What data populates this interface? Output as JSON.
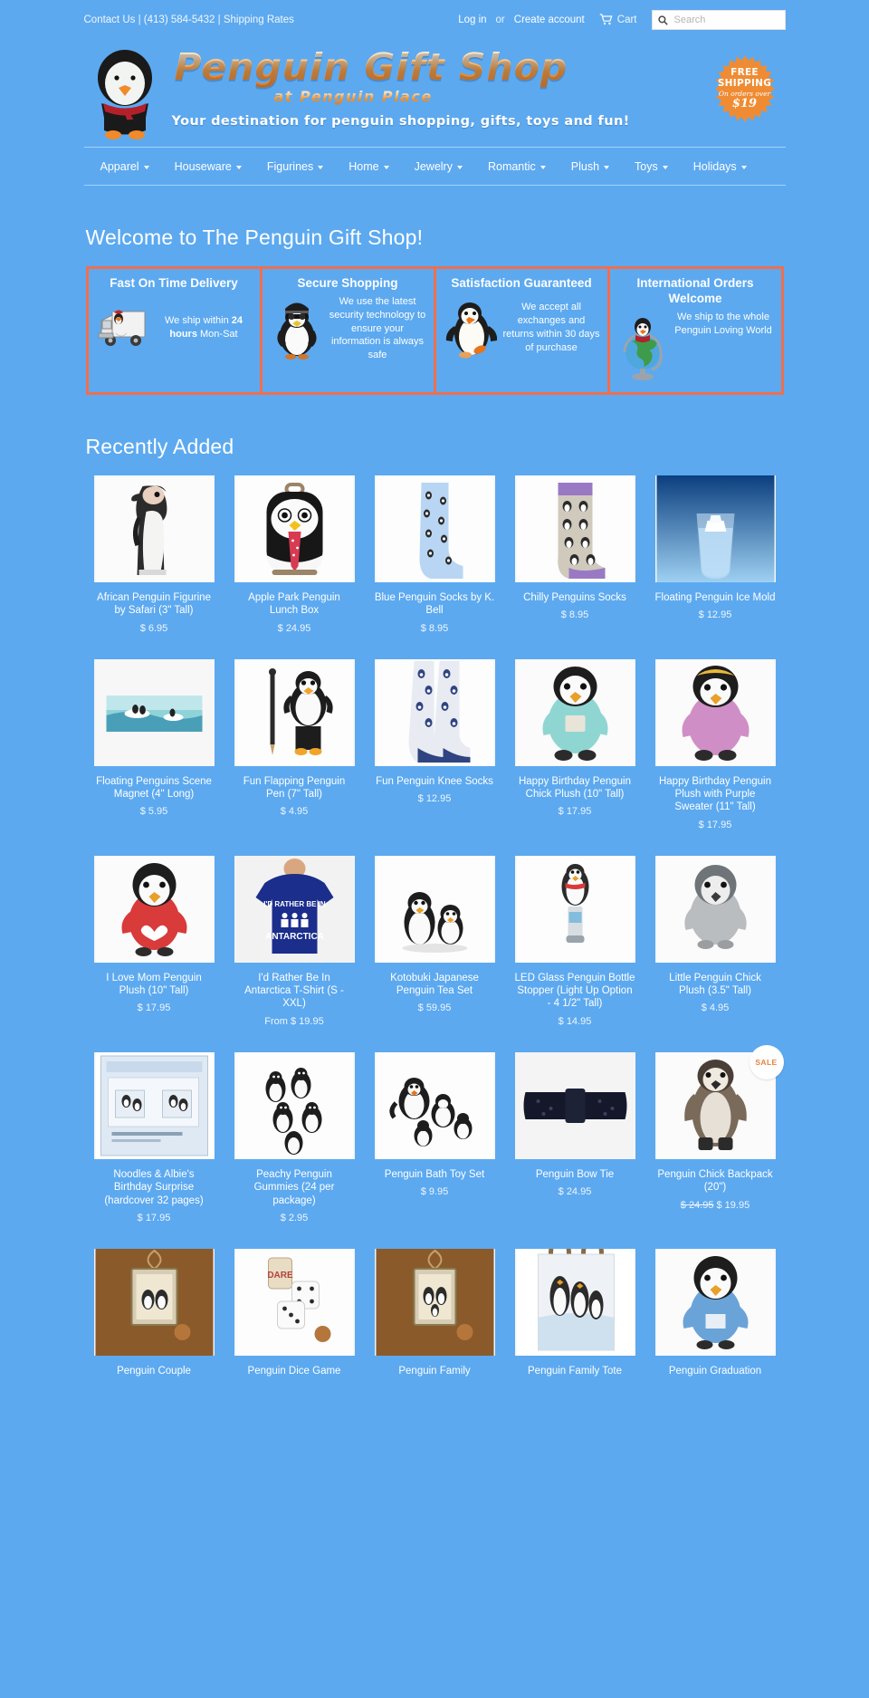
{
  "topbar": {
    "contact": "Contact Us",
    "sep1": "|",
    "phone": "(413) 584-5432",
    "sep2": "|",
    "shipping_rates": "Shipping Rates",
    "login": "Log in",
    "or": "or",
    "create_account": "Create account",
    "cart": "Cart",
    "search_placeholder": "Search",
    "search_value": ""
  },
  "brand": {
    "title": "Penguin Gift Shop",
    "subtitle": "at Penguin Place",
    "tagline": "Your destination for penguin shopping, gifts, toys and fun!",
    "ship_badge": {
      "line1": "FREE",
      "line2": "SHIPPING",
      "line3": "On orders over",
      "line4": "$19"
    }
  },
  "nav": {
    "items": [
      {
        "label": "Apparel",
        "has_dropdown": true
      },
      {
        "label": "Houseware",
        "has_dropdown": true
      },
      {
        "label": "Figurines",
        "has_dropdown": true
      },
      {
        "label": "Home",
        "has_dropdown": true
      },
      {
        "label": "Jewelry",
        "has_dropdown": true
      },
      {
        "label": "Romantic",
        "has_dropdown": true
      },
      {
        "label": "Plush",
        "has_dropdown": true
      },
      {
        "label": "Toys",
        "has_dropdown": true
      },
      {
        "label": "Holidays",
        "has_dropdown": true
      }
    ]
  },
  "welcome": {
    "heading": "Welcome to The Penguin Gift Shop!"
  },
  "features": [
    {
      "title": "Fast On Time Delivery",
      "body_pre": "We ship within ",
      "body_bold": "24 hours",
      "body_post": " Mon-Sat",
      "icon": "delivery-truck-penguin"
    },
    {
      "title": "Secure Shopping",
      "body": "We use the latest security technology to ensure your information is always safe",
      "icon": "police-penguin"
    },
    {
      "title": "Satisfaction Guaranteed",
      "body": "We accept all exchanges and returns within 30 days of purchase",
      "icon": "happy-penguin"
    },
    {
      "title": "International Orders Welcome",
      "body": "We ship to the whole Penguin Loving World",
      "icon": "globe-penguin"
    }
  ],
  "recently_added": {
    "heading": "Recently Added",
    "products": [
      {
        "title": "African Penguin Figurine by Safari (3\" Tall)",
        "price": "$ 6.95",
        "art": "penguin-figurine"
      },
      {
        "title": "Apple Park Penguin Lunch Box",
        "price": "$ 24.95",
        "art": "lunch-box"
      },
      {
        "title": "Blue Penguin Socks by K. Bell",
        "price": "$ 8.95",
        "art": "blue-sock"
      },
      {
        "title": "Chilly Penguins Socks",
        "price": "$ 8.95",
        "art": "grey-sock"
      },
      {
        "title": "Floating Penguin Ice Mold",
        "price": "$ 12.95",
        "art": "ice-glass"
      },
      {
        "title": "Floating Penguins Scene Magnet (4\" Long)",
        "price": "$ 5.95",
        "art": "scene-magnet"
      },
      {
        "title": "Fun Flapping Penguin Pen (7\" Tall)",
        "price": "$ 4.95",
        "art": "penguin-pen"
      },
      {
        "title": "Fun Penguin Knee Socks",
        "price": "$ 12.95",
        "art": "knee-socks"
      },
      {
        "title": "Happy Birthday Penguin Chick Plush (10\" Tall)",
        "price": "$ 17.95",
        "art": "teal-sweater-plush"
      },
      {
        "title": "Happy Birthday Penguin Plush with Purple Sweater (11\" Tall)",
        "price": "$ 17.95",
        "art": "purple-sweater-plush"
      },
      {
        "title": "I Love Mom Penguin Plush (10\" Tall)",
        "price": "$ 17.95",
        "art": "love-mom-plush"
      },
      {
        "title": "I'd Rather Be In Antarctica T-Shirt (S - XXL)",
        "price": "From $ 19.95",
        "art": "tshirt"
      },
      {
        "title": "Kotobuki Japanese Penguin Tea Set",
        "price": "$ 59.95",
        "art": "tea-set"
      },
      {
        "title": "LED Glass Penguin Bottle Stopper (Light Up Option - 4 1/2\" Tall)",
        "price": "$ 14.95",
        "art": "bottle-stopper"
      },
      {
        "title": "Little Penguin Chick Plush (3.5\" Tall)",
        "price": "$ 4.95",
        "art": "chick-plush"
      },
      {
        "title": "Noodles & Albie's Birthday Surprise (hardcover 32 pages)",
        "price": "$ 17.95",
        "art": "book"
      },
      {
        "title": "Peachy Penguin Gummies (24 per package)",
        "price": "$ 2.95",
        "art": "gummies"
      },
      {
        "title": "Penguin Bath Toy Set",
        "price": "$ 9.95",
        "art": "bath-toys"
      },
      {
        "title": "Penguin Bow Tie",
        "price": "$ 24.95",
        "art": "bow-tie"
      },
      {
        "title": "Penguin Chick Backpack (20\")",
        "price": "$ 19.95",
        "price_old": "$ 24.95",
        "badge": "SALE",
        "art": "backpack"
      },
      {
        "title": "Penguin Couple",
        "price": "",
        "art": "pendant-couple"
      },
      {
        "title": "Penguin Dice Game",
        "price": "",
        "art": "dice-game"
      },
      {
        "title": "Penguin Family",
        "price": "",
        "art": "pendant-family"
      },
      {
        "title": "Penguin Family Tote",
        "price": "",
        "art": "tote-bag"
      },
      {
        "title": "Penguin Graduation",
        "price": "",
        "art": "graduation-plush"
      }
    ]
  },
  "colors": {
    "background": "#5ca9f0",
    "feature_border": "#ef6f4f",
    "brand_orange": "#f79127",
    "text": "#ffffff"
  }
}
